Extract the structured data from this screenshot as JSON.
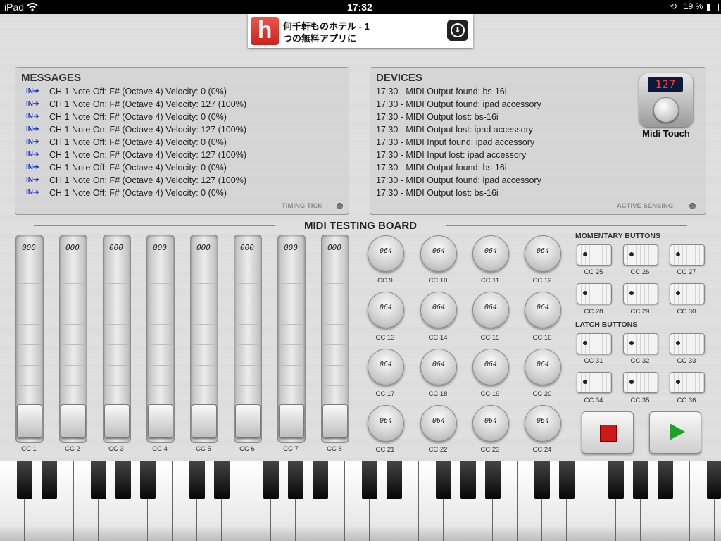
{
  "status": {
    "device": "iPad",
    "time": "17:32",
    "battery": "19 %"
  },
  "ad": {
    "line1": "何千軒ものホテル - 1",
    "line2": "つの無料アプリに",
    "logo_letter": "h"
  },
  "messages": {
    "title": "MESSAGES",
    "in_label": "IN➔",
    "lines": [
      "CH 1 Note Off: F# (Octave 4) Velocity: 0 (0%)",
      "CH 1 Note On: F# (Octave 4) Velocity: 127 (100%)",
      "CH 1 Note Off: F# (Octave 4) Velocity: 0 (0%)",
      "CH 1 Note On: F# (Octave 4) Velocity: 127 (100%)",
      "CH 1 Note Off: F# (Octave 4) Velocity: 0 (0%)",
      "CH 1 Note On: F# (Octave 4) Velocity: 127 (100%)",
      "CH 1 Note Off: F# (Octave 4) Velocity: 0 (0%)",
      "CH 1 Note On: F# (Octave 4) Velocity: 127 (100%)",
      "CH 1 Note Off: F# (Octave 4) Velocity: 0 (0%)"
    ],
    "footer": "TIMING TICK"
  },
  "devices": {
    "title": "DEVICES",
    "lines": [
      "17:30 - MIDI Output found: bs-16i",
      "17:30 - MIDI Output found: ipad accessory",
      "17:30 - MIDI Output lost: bs-16i",
      "17:30 - MIDI Output lost: ipad accessory",
      "17:30 - MIDI Input found: ipad accessory",
      "17:30 - MIDI Input lost: ipad accessory",
      "17:30 - MIDI Output found: bs-16i",
      "17:30 - MIDI Output found: ipad accessory",
      "17:30 - MIDI Output lost: bs-16i"
    ],
    "footer": "ACTIVE SENSING",
    "app_name": "Midi Touch",
    "app_display": "127"
  },
  "board": {
    "title": "MIDI TESTING BOARD",
    "sliders": [
      {
        "label": "CC 1",
        "value": "000"
      },
      {
        "label": "CC 2",
        "value": "000"
      },
      {
        "label": "CC 3",
        "value": "000"
      },
      {
        "label": "CC 4",
        "value": "000"
      },
      {
        "label": "CC 5",
        "value": "000"
      },
      {
        "label": "CC 6",
        "value": "000"
      },
      {
        "label": "CC 7",
        "value": "000"
      },
      {
        "label": "CC 8",
        "value": "000"
      }
    ],
    "knobs": [
      {
        "label": "CC 9",
        "value": "064"
      },
      {
        "label": "CC 10",
        "value": "064"
      },
      {
        "label": "CC 11",
        "value": "064"
      },
      {
        "label": "CC 12",
        "value": "064"
      },
      {
        "label": "CC 13",
        "value": "064"
      },
      {
        "label": "CC 14",
        "value": "064"
      },
      {
        "label": "CC 15",
        "value": "064"
      },
      {
        "label": "CC 16",
        "value": "064"
      },
      {
        "label": "CC 17",
        "value": "064"
      },
      {
        "label": "CC 18",
        "value": "064"
      },
      {
        "label": "CC 19",
        "value": "064"
      },
      {
        "label": "CC 20",
        "value": "064"
      },
      {
        "label": "CC 21",
        "value": "064"
      },
      {
        "label": "CC 22",
        "value": "064"
      },
      {
        "label": "CC 23",
        "value": "064"
      },
      {
        "label": "CC 24",
        "value": "064"
      }
    ],
    "momentary_title": "MOMENTARY BUTTONS",
    "momentary": [
      "CC 25",
      "CC 26",
      "CC 27",
      "CC 28",
      "CC 29",
      "CC 30"
    ],
    "latch_title": "LATCH BUTTONS",
    "latch": [
      "CC 31",
      "CC 32",
      "CC 33",
      "CC 34",
      "CC 35",
      "CC 36"
    ]
  },
  "transport": {
    "stop": "stop-icon",
    "play": "play-icon",
    "stop_color": "#d01818",
    "play_color": "#1fa02a"
  }
}
